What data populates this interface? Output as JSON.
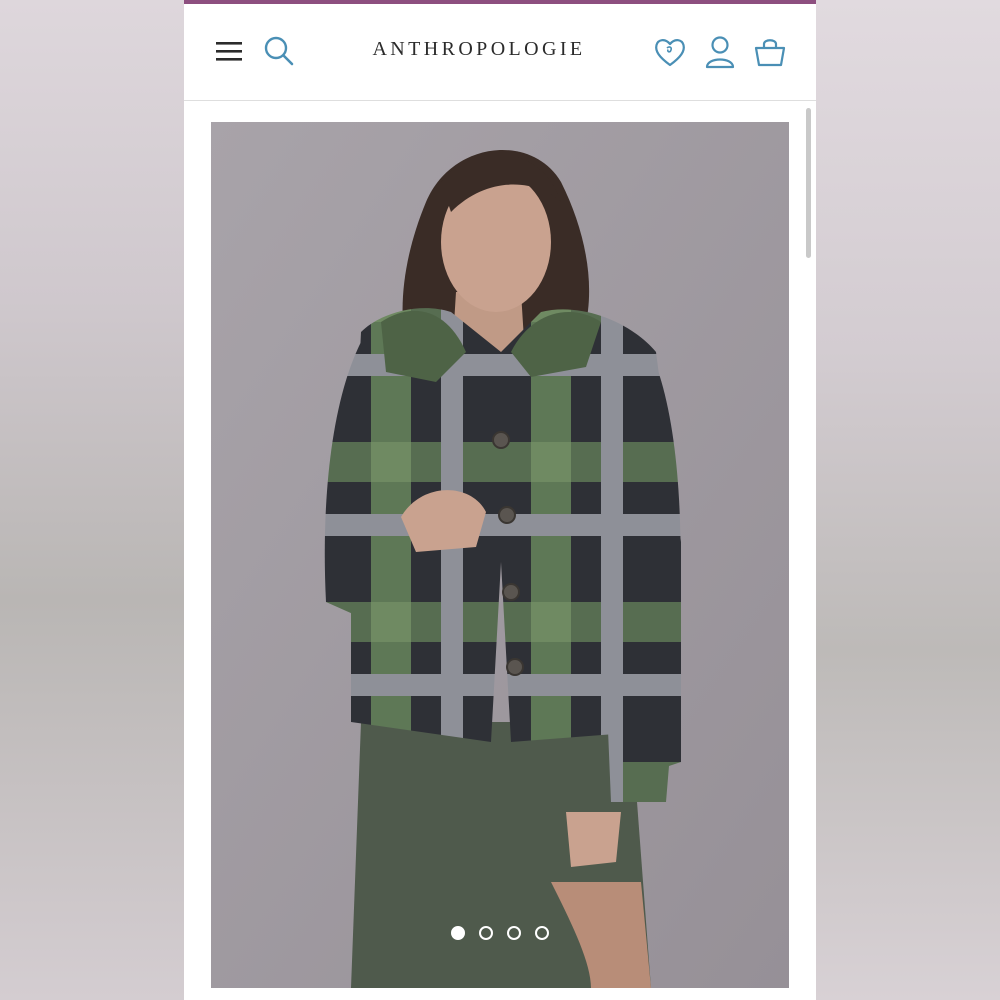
{
  "header": {
    "brand": "ANTHROPOLOGIE",
    "icons": {
      "menu": "hamburger-menu-icon",
      "search": "search-icon",
      "wishlist": "heart-icon",
      "account": "user-icon",
      "bag": "shopping-bag-icon"
    }
  },
  "colors": {
    "accent": "#8d4f7f",
    "icon": "#4a8fb5",
    "text": "#2b2b2b"
  },
  "product": {
    "image": "plaid-shirt-jacket-photo",
    "carousel": {
      "total": 4,
      "active": 1
    }
  }
}
